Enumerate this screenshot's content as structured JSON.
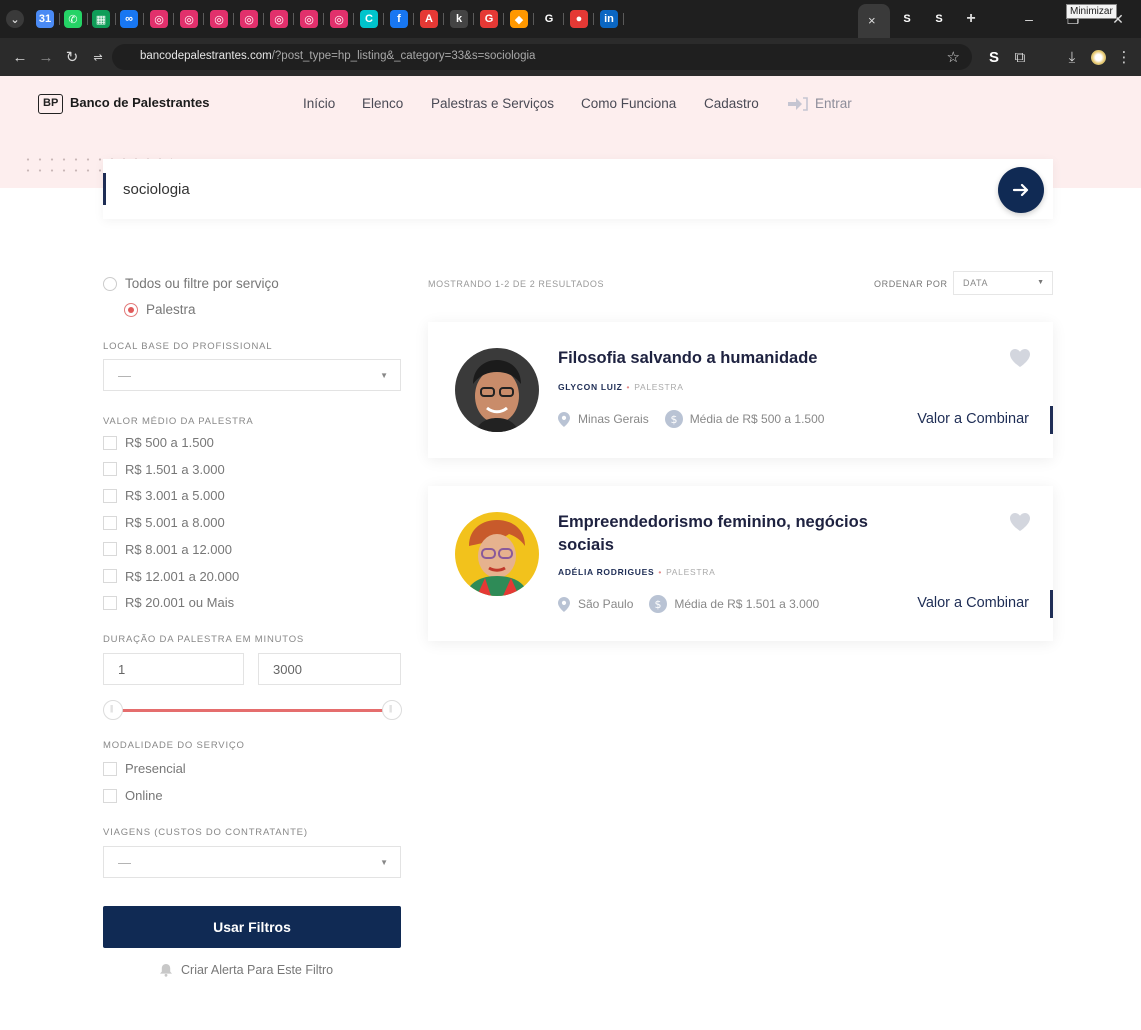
{
  "browser": {
    "url_domain": "bancodepalestrantes.com",
    "url_path": "/?post_type=hp_listing&_category=33&s=sociologia",
    "tooltip": "Minimizar",
    "new_tab_symbol": "+",
    "close_tab_symbol": "×",
    "tab_favicons": [
      {
        "icon": "tab-icon-calendar",
        "color": "#4a8af4",
        "glyph": "31"
      },
      {
        "icon": "tab-icon-whatsapp",
        "color": "#25d366",
        "glyph": "✆"
      },
      {
        "icon": "tab-icon-sheets",
        "color": "#0f9d58",
        "glyph": "▦"
      },
      {
        "icon": "tab-icon-meta",
        "color": "#1877f2",
        "glyph": "∞"
      },
      {
        "icon": "tab-icon-instagram",
        "color": "#e1306c",
        "glyph": "◎"
      },
      {
        "icon": "tab-icon-instagram",
        "color": "#e1306c",
        "glyph": "◎"
      },
      {
        "icon": "tab-icon-instagram",
        "color": "#e1306c",
        "glyph": "◎"
      },
      {
        "icon": "tab-icon-instagram",
        "color": "#e1306c",
        "glyph": "◎"
      },
      {
        "icon": "tab-icon-instagram",
        "color": "#e1306c",
        "glyph": "◎"
      },
      {
        "icon": "tab-icon-instagram",
        "color": "#e1306c",
        "glyph": "◎"
      },
      {
        "icon": "tab-icon-instagram",
        "color": "#e1306c",
        "glyph": "◎"
      },
      {
        "icon": "tab-icon-canva",
        "color": "#00c4cc",
        "glyph": "C"
      },
      {
        "icon": "tab-icon-facebook",
        "color": "#1877f2",
        "glyph": "f"
      },
      {
        "icon": "tab-icon-adobe",
        "color": "#e53935",
        "glyph": "A"
      },
      {
        "icon": "tab-icon-kapwing",
        "color": "#444444",
        "glyph": "k"
      },
      {
        "icon": "tab-icon-grammarly",
        "color": "#e53935",
        "glyph": "G"
      },
      {
        "icon": "tab-icon-colorful",
        "color": "#ff9800",
        "glyph": "◆"
      },
      {
        "icon": "tab-icon-google",
        "color": "#ffffff",
        "glyph": "G"
      },
      {
        "icon": "tab-icon-red-circle",
        "color": "#e53935",
        "glyph": "●"
      },
      {
        "icon": "tab-icon-linkedin",
        "color": "#0a66c2",
        "glyph": "in"
      },
      {
        "icon": "tab-icon-site-s",
        "color": "#ffffff",
        "glyph": "S"
      },
      {
        "icon": "tab-icon-site-s",
        "color": "#ffffff",
        "glyph": "S"
      }
    ]
  },
  "site": {
    "logo_mark": "BP",
    "logo_text": "Banco de Palestrantes",
    "nav": [
      "Início",
      "Elenco",
      "Palestras e Serviços",
      "Como Funciona",
      "Cadastro"
    ],
    "login_label": "Entrar",
    "colors": {
      "navy": "#102a54",
      "accent_red": "#e56d6d",
      "header_bg": "#fdeeee"
    }
  },
  "search": {
    "query": "sociologia"
  },
  "filters": {
    "service_all": "Todos ou filtre por serviço",
    "service_selected": "Palestra",
    "location_label": "Local base do profissional",
    "location_value": "—",
    "price_label": "Valor médio da palestra",
    "price_options": [
      "R$ 500 a 1.500",
      "R$ 1.501 a 3.000",
      "R$ 3.001 a 5.000",
      "R$ 5.001 a 8.000",
      "R$ 8.001 a 12.000",
      "R$ 12.001 a 20.000",
      "R$ 20.001 ou Mais"
    ],
    "duration_label": "Duração da palestra em minutos",
    "duration_min": "1",
    "duration_max": "3000",
    "modality_label": "Modalidade do serviço",
    "modality_options": [
      "Presencial",
      "Online"
    ],
    "travel_label": "Viagens (custos do contratante)",
    "travel_value": "—",
    "apply_label": "Usar Filtros",
    "alert_label": "Criar Alerta Para Este Filtro"
  },
  "results": {
    "count_text": "Mostrando 1-2 de 2 resultados",
    "sort_label": "Ordenar por",
    "sort_value": "Data",
    "items": [
      {
        "title": "Filosofia salvando a humanidade",
        "author": "Glycon Luiz",
        "kind": "Palestra",
        "location": "Minas Gerais",
        "price_range": "Média de R$ 500 a 1.500",
        "price": "Valor a Combinar"
      },
      {
        "title": "Empreendedorismo feminino, negócios sociais",
        "author": "Adélia Rodrigues",
        "kind": "Palestra",
        "location": "São Paulo",
        "price_range": "Média de R$ 1.501 a 3.000",
        "price": "Valor a Combinar"
      }
    ]
  }
}
